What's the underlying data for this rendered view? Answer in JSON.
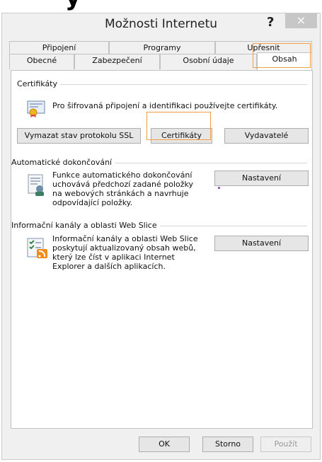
{
  "window": {
    "title": "Možnosti Internetu",
    "help": "?",
    "close": "×"
  },
  "tabs_back": [
    {
      "label": "Připojení"
    },
    {
      "label": "Programy"
    },
    {
      "label": "Upřesnit"
    }
  ],
  "tabs_front": [
    {
      "label": "Obecné"
    },
    {
      "label": "Zabezpečení"
    },
    {
      "label": "Osobní údaje"
    },
    {
      "label": "Obsah"
    }
  ],
  "certificates": {
    "title": "Certifikáty",
    "description": "Pro šifrovaná připojení a identifikaci používejte certifikáty.",
    "clear_ssl": "Vymazat stav protokolu SSL",
    "certificates_btn": "Certifikáty",
    "publishers": "Vydavatelé"
  },
  "autocomplete": {
    "title": "Automatické dokončování",
    "description": "Funkce automatického dokončování uchovává předchozí zadané položky na webových stránkách a navrhuje odpovídající položky.",
    "settings": "Nastavení"
  },
  "feeds": {
    "title": "Informační kanály a oblasti Web Slice",
    "description": "Informační kanály a oblasti Web Slice poskytují aktualizovaný obsah webů, který lze číst v aplikaci Internet Explorer a dalších aplikacích.",
    "settings": "Nastavení"
  },
  "footer": {
    "ok": "OK",
    "cancel": "Storno",
    "apply": "Použít"
  }
}
